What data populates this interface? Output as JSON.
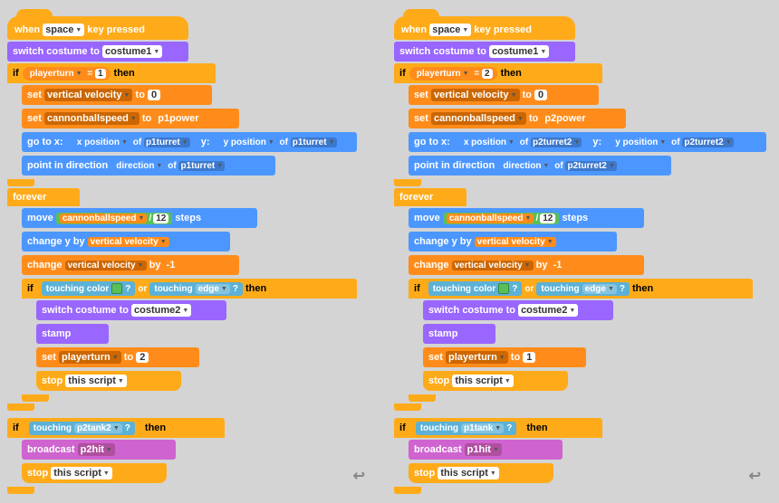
{
  "col1": {
    "hat": "when space ▼ key pressed",
    "switch_costume_1": "switch costume to costume1 ▼",
    "if_condition_1": "playerturn = 1",
    "set_vertical_1": "set vertical velocity ▼ to 0",
    "set_cannon_1": "set cannonballspeed ▼ to p1power",
    "goto": "go to x: x position ▼ of p1turret    y: y position ▼ of p1turret",
    "point_dir": "point in direction direction ▼ of p1turret",
    "forever": "forever",
    "move": "move cannonballspeed / 12 steps",
    "change_y": "change y by vertical velocity",
    "change_vel": "change vertical velocity ▼ by -1",
    "if_touching": "if touching color ? or touching edge ▼ ? then",
    "switch_costume_2": "switch costume to costume2 ▼",
    "stamp": "stamp",
    "set_playerturn": "set playerturn ▼ to 2",
    "stop_1": "stop this script ▼",
    "if_p2tank": "if touching p2tank2 ▼ ? then",
    "broadcast_p2hit": "broadcast p2hit ▼",
    "stop_2": "stop this script ▼"
  },
  "col2": {
    "hat": "when space ▼ key pressed",
    "switch_costume_1": "switch costume to costume1 ▼",
    "if_condition_1": "playerturn = 2",
    "set_vertical_1": "set vertical velocity ▼ to 0",
    "set_cannon_1": "set cannonballspeed ▼ to p2power",
    "goto": "go to x: x position ▼ of p2turret2    y: y position ▼ of p2turret2",
    "point_dir": "point in direction direction ▼ of p2turret2",
    "forever": "forever",
    "move": "move cannonballspeed / 12 steps",
    "change_y": "change y by vertical velocity",
    "change_vel": "change vertical velocity ▼ by -1",
    "if_touching": "if touching color ? or touching edge ▼ ? then",
    "switch_costume_2": "switch costume to costume2 ▼",
    "stamp": "stamp",
    "set_playerturn": "set playerturn ▼ to 1",
    "stop_1": "stop this script ▼",
    "if_p1tank": "if touching p1tank ▼ ? then",
    "broadcast_p1hit": "broadcast p1hit ▼",
    "stop_2": "stop this script ▼"
  }
}
